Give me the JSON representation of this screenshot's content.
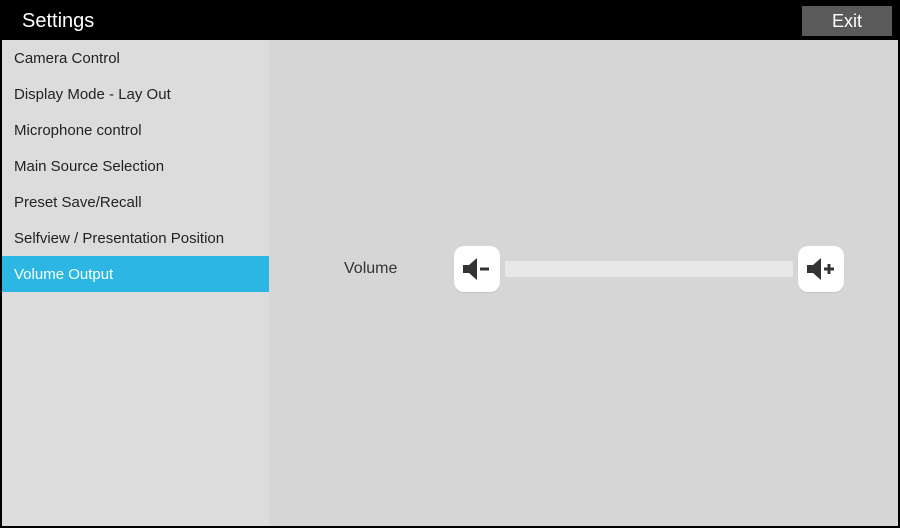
{
  "header": {
    "title": "Settings",
    "exit_label": "Exit"
  },
  "sidebar": {
    "items": [
      {
        "label": "Camera Control",
        "active": false
      },
      {
        "label": "Display Mode - Lay Out",
        "active": false
      },
      {
        "label": "Microphone control",
        "active": false
      },
      {
        "label": "Main Source Selection",
        "active": false
      },
      {
        "label": "Preset Save/Recall",
        "active": false
      },
      {
        "label": "Selfview / Presentation Position",
        "active": false
      },
      {
        "label": "Volume Output",
        "active": true
      }
    ]
  },
  "main": {
    "volume_label": "Volume"
  }
}
